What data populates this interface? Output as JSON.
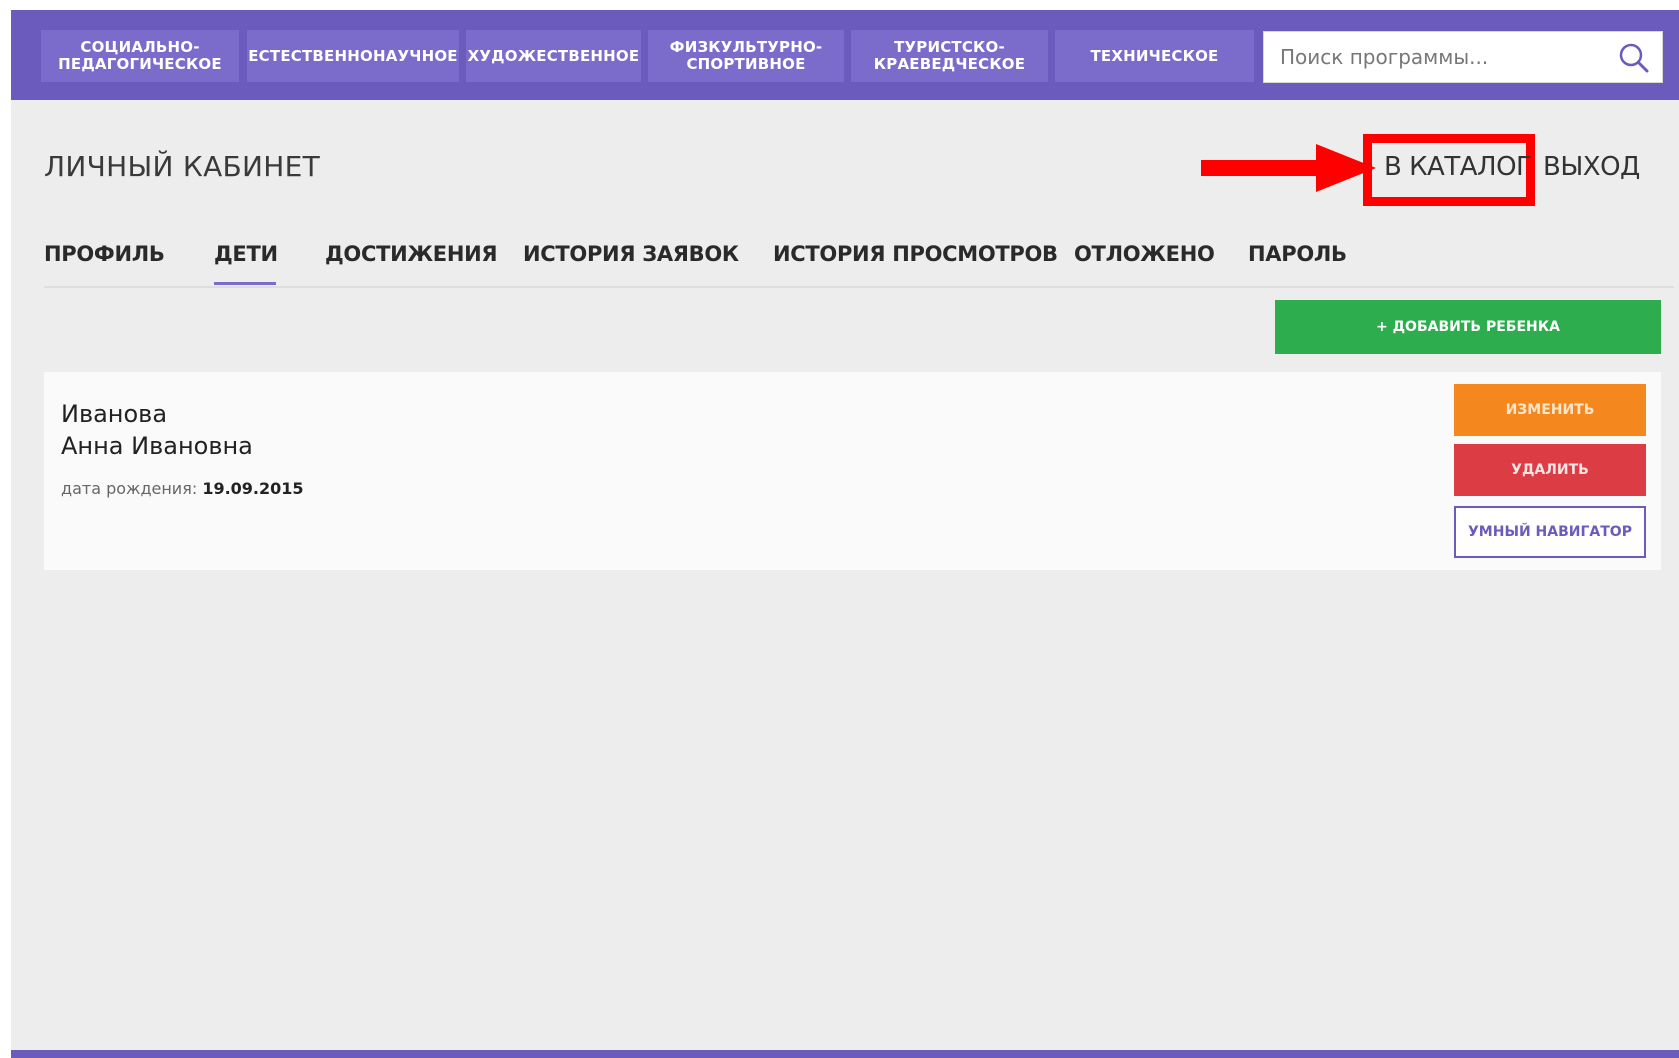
{
  "nav": {
    "categories": [
      {
        "label": "СОЦИАЛЬНО-\nПЕДАГОГИЧЕСКОЕ"
      },
      {
        "label": "ЕСТЕСТВЕННОНАУЧНОЕ"
      },
      {
        "label": "ХУДОЖЕСТВЕННОЕ"
      },
      {
        "label": "ФИЗКУЛЬТУРНО-\nСПОРТИВНОЕ"
      },
      {
        "label": "ТУРИСТСКО-\nКРАЕВЕДЧЕСКОЕ"
      },
      {
        "label": "ТЕХНИЧЕСКОЕ"
      }
    ],
    "search": {
      "placeholder": "Поиск программы...",
      "value": "",
      "icon": "search-icon"
    }
  },
  "header": {
    "title": "ЛИЧНЫЙ КАБИНЕТ",
    "catalog_link": "В КАТАЛОГ",
    "logout_link": "ВЫХОД",
    "highlight_color": "#ff0000"
  },
  "tabs": [
    {
      "label": "ПРОФИЛЬ"
    },
    {
      "label": "ДЕТИ",
      "active": true
    },
    {
      "label": "ДОСТИЖЕНИЯ"
    },
    {
      "label": "ИСТОРИЯ ЗАЯВОК"
    },
    {
      "label": "ИСТОРИЯ ПРОСМОТРОВ"
    },
    {
      "label": "ОТЛОЖЕНО"
    },
    {
      "label": "ПАРОЛЬ"
    }
  ],
  "children": {
    "add_button": "+ ДОБАВИТЬ РЕБЕНКА",
    "items": [
      {
        "last_name": "Иванова",
        "first_names": "Анна Ивановна",
        "birth_label": "дата рождения:",
        "birth_date": "19.09.2015",
        "edit_button": "ИЗМЕНИТЬ",
        "delete_button": "УДАЛИТЬ",
        "navigator_button": "УМНЫЙ НАВИГАТОР"
      }
    ]
  },
  "colors": {
    "brand": "#6a5bbd",
    "category_bg": "#7b6ccb",
    "success": "#2dad4e",
    "warning": "#f5871f",
    "danger": "#dc3d44",
    "annotation": "#ff0000"
  }
}
